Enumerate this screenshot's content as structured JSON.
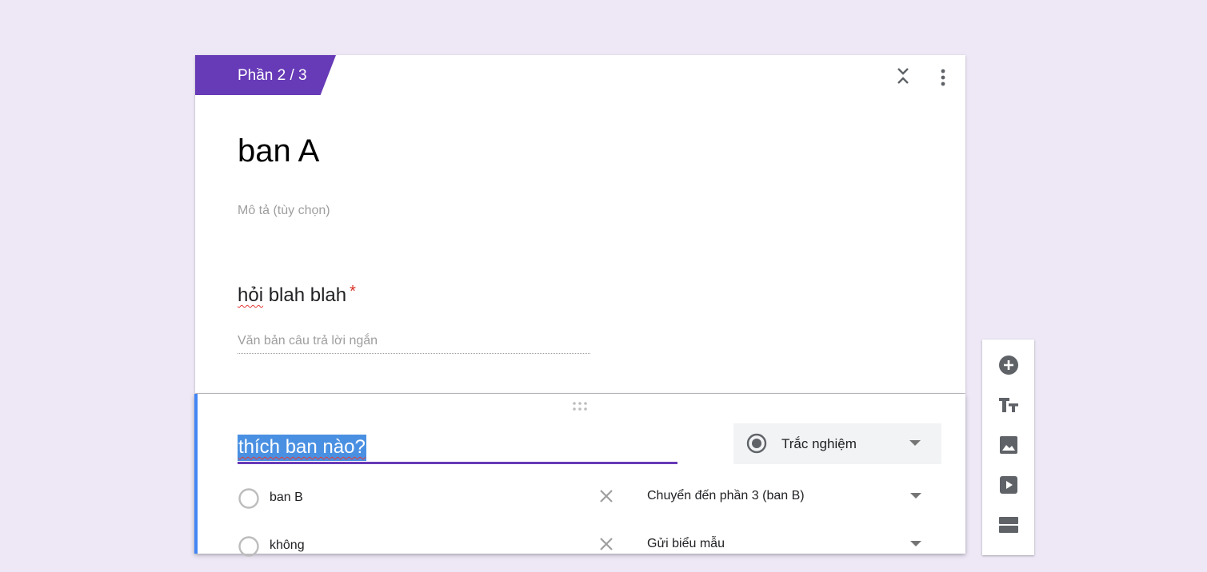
{
  "section": {
    "indicator": "Phần 2 / 3",
    "title": "ban A",
    "description_placeholder": "Mô tả (tùy chọn)"
  },
  "question1": {
    "title_part1": "hỏi",
    "title_part2": " blah blah",
    "required_mark": "*",
    "answer_placeholder": "Văn bản câu trả lời ngắn"
  },
  "question2": {
    "title": "thích ban nào?",
    "type_label": "Trắc nghiệm",
    "options": [
      {
        "label": "ban B",
        "goto": "Chuyển đến phần 3 (ban B)"
      },
      {
        "label": "không",
        "goto": "Gửi biểu mẫu"
      }
    ]
  },
  "toolbar": {
    "items": [
      "add-question-icon",
      "add-title-icon",
      "add-image-icon",
      "add-video-icon",
      "add-section-icon"
    ]
  },
  "colors": {
    "background": "#ede7f6",
    "accent_purple": "#673ab7",
    "accent_blue": "#4285f4",
    "required_red": "#d93025"
  }
}
